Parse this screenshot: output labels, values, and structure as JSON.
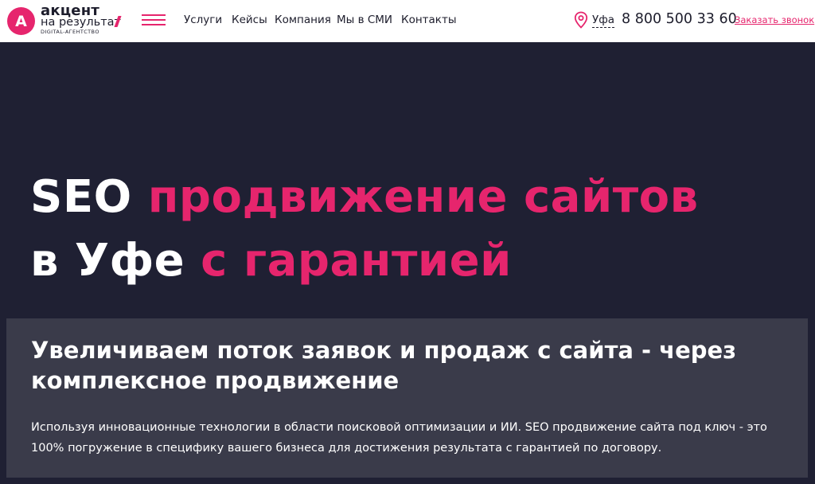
{
  "header": {
    "logo": {
      "letter": "А",
      "line1": "акцент",
      "line2": "на результат",
      "line3": "DIGITAL-АГЕНТСТВО"
    },
    "nav": [
      "Услуги",
      "Кейсы",
      "Компания",
      "Мы в СМИ",
      "Контакты"
    ],
    "city": "Уфа",
    "phone": "8 800 500 33 60",
    "callback": "Заказать звонок"
  },
  "hero": {
    "line1_white": "SEO",
    "line1_pink": "продвижение сайтов",
    "line2_white": "в Уфе",
    "line2_pink": "с гарантией"
  },
  "subpanel": {
    "heading": "Увеличиваем поток заявок и продаж с сайта - через комплексное продвижение",
    "text": "Используя инновационные технологии в области поисковой оптимизации и ИИ. SEO продвижение сайта под ключ - это 100% погружение в специфику вашего бизнеса для достижения результата с гарантией по договору."
  },
  "colors": {
    "accent": "#e6256d",
    "background": "#1f2033",
    "panel": "#3a3b4a"
  },
  "icons": [
    "burger-menu-icon",
    "location-pin-icon"
  ]
}
